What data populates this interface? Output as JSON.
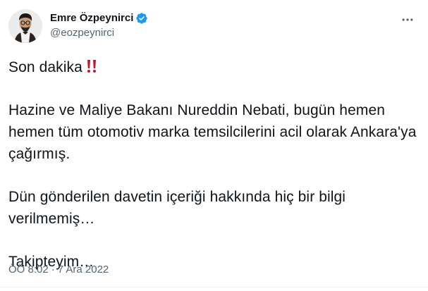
{
  "author": {
    "display_name": "Emre Özpeynirci",
    "handle": "@eozpeynirci",
    "verified": true,
    "verified_color": "#1d9bf0"
  },
  "more_icon": "more-dots-icon",
  "tweet": {
    "headline": "Son dakika",
    "headline_emoji": "double-exclamation-mark-icon",
    "paragraphs": [
      "Hazine ve Maliye Bakanı Nureddin Nebati, bugün hemen hemen tüm otomotiv marka temsilcilerini acil olarak Ankara'ya çağırmış.",
      "Dün gönderilen davetin içeriği hakkında hiç bir bilgi verilmemiş…",
      "Takipteyim…"
    ]
  },
  "meta": {
    "time": "ÖÖ 8:02",
    "separator": "·",
    "date": "7 Ara 2022"
  },
  "colors": {
    "text": "#0f1419",
    "secondary": "#536471",
    "emoji_red": "#be1931"
  }
}
